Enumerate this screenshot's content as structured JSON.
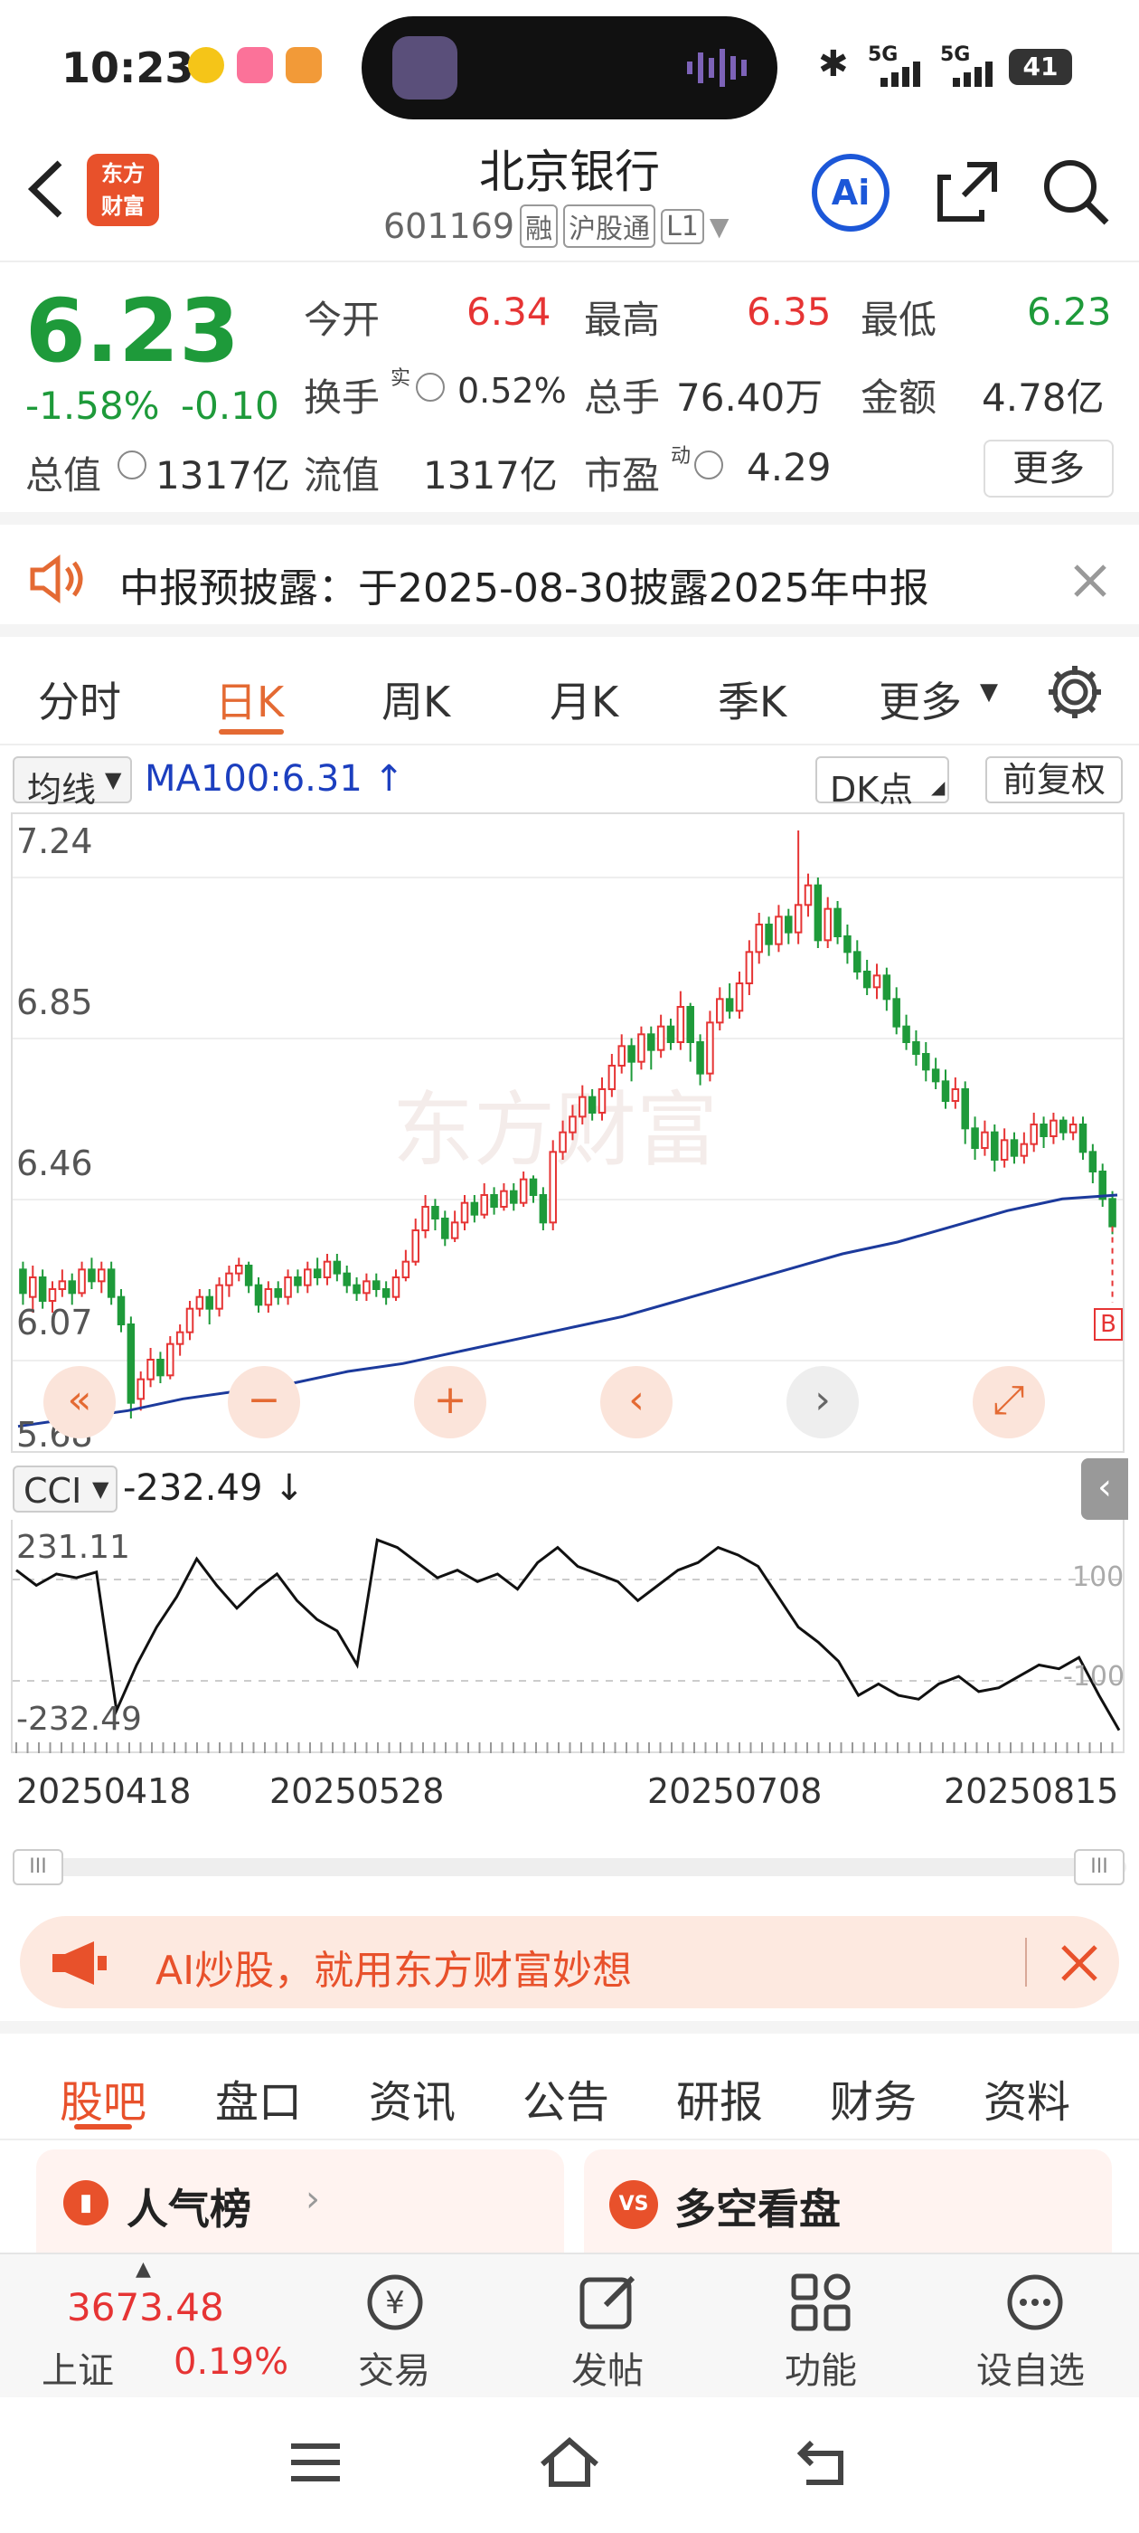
{
  "status": {
    "time": "10:23",
    "battery": "41",
    "sig1": "5G",
    "sig2": "5G"
  },
  "header": {
    "logo_line1": "东方",
    "logo_line2": "财富",
    "title": "北京银行",
    "code": "601169",
    "tag1": "融",
    "tag2": "沪股通",
    "tag3": "L1",
    "ai_label": "Ai"
  },
  "quote": {
    "price": "6.23",
    "change_pct": "-1.58%",
    "change": "-0.10",
    "open_label": "今开",
    "open": "6.34",
    "high_label": "最高",
    "high": "6.35",
    "low_label": "最低",
    "low": "6.23",
    "turnover_label": "换手",
    "turnover_sup": "实",
    "turnover": "0.52%",
    "volume_label": "总手",
    "volume": "76.40万",
    "amount_label": "金额",
    "amount": "4.78亿",
    "mktcap_label": "总值",
    "mktcap": "1317亿",
    "float_label": "流值",
    "float_cap": "1317亿",
    "pe_label": "市盈",
    "pe_sup": "动",
    "pe": "4.29",
    "more_label": "更多"
  },
  "notice": {
    "text": "中报预披露：于2025-08-30披露2025年中报"
  },
  "period_tabs": [
    "分时",
    "日K",
    "周K",
    "月K",
    "季K",
    "更多"
  ],
  "chart_controls": {
    "ma_select": "均线",
    "ma_value": "MA100:6.31 ↑",
    "dk_select": "DK点",
    "adjust": "前复权",
    "b_marker": "B"
  },
  "indicator": {
    "name": "CCI",
    "value": "-232.49 ↓",
    "axis_top": "231.11",
    "axis_bottom": "-232.49",
    "ref_hi": "100",
    "ref_lo": "-100"
  },
  "chart_data": {
    "type": "candlestick",
    "y_ticks": [
      "7.24",
      "6.85",
      "6.46",
      "6.07",
      "5.68"
    ],
    "ylim": [
      5.68,
      7.24
    ],
    "x_ticks": [
      "20250418",
      "20250528",
      "20250708",
      "20250815"
    ],
    "watermark": "东方财富",
    "candles": [
      [
        6.12,
        6.06,
        6.14,
        6.03
      ],
      [
        6.05,
        6.1,
        6.13,
        6.01
      ],
      [
        6.1,
        6.04,
        6.12,
        6.02
      ],
      [
        6.04,
        6.07,
        6.09,
        6.01
      ],
      [
        6.07,
        6.09,
        6.12,
        6.05
      ],
      [
        6.09,
        6.06,
        6.11,
        6.03
      ],
      [
        6.06,
        6.12,
        6.14,
        6.05
      ],
      [
        6.12,
        6.09,
        6.15,
        6.07
      ],
      [
        6.09,
        6.12,
        6.14,
        6.06
      ],
      [
        6.12,
        6.05,
        6.14,
        6.03
      ],
      [
        6.05,
        5.98,
        6.07,
        5.96
      ],
      [
        5.98,
        5.78,
        6.0,
        5.74
      ],
      [
        5.79,
        5.84,
        5.86,
        5.76
      ],
      [
        5.84,
        5.89,
        5.92,
        5.82
      ],
      [
        5.89,
        5.85,
        5.91,
        5.83
      ],
      [
        5.85,
        5.93,
        5.95,
        5.84
      ],
      [
        5.93,
        5.96,
        5.98,
        5.9
      ],
      [
        5.96,
        6.02,
        6.04,
        5.94
      ],
      [
        6.02,
        6.05,
        6.07,
        6.0
      ],
      [
        6.05,
        6.02,
        6.07,
        5.98
      ],
      [
        6.02,
        6.08,
        6.1,
        6.0
      ],
      [
        6.08,
        6.11,
        6.13,
        6.05
      ],
      [
        6.11,
        6.13,
        6.15,
        6.09
      ],
      [
        6.13,
        6.08,
        6.14,
        6.06
      ],
      [
        6.08,
        6.03,
        6.1,
        6.01
      ],
      [
        6.03,
        6.07,
        6.09,
        6.01
      ],
      [
        6.07,
        6.05,
        6.09,
        6.03
      ],
      [
        6.05,
        6.1,
        6.12,
        6.03
      ],
      [
        6.1,
        6.08,
        6.12,
        6.06
      ],
      [
        6.08,
        6.12,
        6.14,
        6.06
      ],
      [
        6.12,
        6.1,
        6.15,
        6.08
      ],
      [
        6.1,
        6.14,
        6.16,
        6.08
      ],
      [
        6.14,
        6.11,
        6.16,
        6.09
      ],
      [
        6.11,
        6.08,
        6.13,
        6.06
      ],
      [
        6.08,
        6.06,
        6.1,
        6.04
      ],
      [
        6.06,
        6.09,
        6.11,
        6.04
      ],
      [
        6.09,
        6.07,
        6.11,
        6.05
      ],
      [
        6.07,
        6.05,
        6.09,
        6.03
      ],
      [
        6.05,
        6.1,
        6.12,
        6.04
      ],
      [
        6.1,
        6.14,
        6.17,
        6.09
      ],
      [
        6.14,
        6.22,
        6.25,
        6.13
      ],
      [
        6.22,
        6.28,
        6.31,
        6.2
      ],
      [
        6.28,
        6.25,
        6.3,
        6.22
      ],
      [
        6.25,
        6.2,
        6.27,
        6.18
      ],
      [
        6.2,
        6.24,
        6.27,
        6.19
      ],
      [
        6.24,
        6.29,
        6.31,
        6.22
      ],
      [
        6.29,
        6.26,
        6.31,
        6.24
      ],
      [
        6.26,
        6.31,
        6.34,
        6.25
      ],
      [
        6.31,
        6.28,
        6.33,
        6.26
      ],
      [
        6.28,
        6.32,
        6.34,
        6.27
      ],
      [
        6.32,
        6.29,
        6.34,
        6.27
      ],
      [
        6.29,
        6.35,
        6.37,
        6.28
      ],
      [
        6.35,
        6.31,
        6.36,
        6.29
      ],
      [
        6.31,
        6.24,
        6.33,
        6.22
      ],
      [
        6.24,
        6.42,
        6.45,
        6.22
      ],
      [
        6.42,
        6.47,
        6.5,
        6.4
      ],
      [
        6.47,
        6.51,
        6.54,
        6.45
      ],
      [
        6.51,
        6.56,
        6.59,
        6.49
      ],
      [
        6.56,
        6.52,
        6.58,
        6.5
      ],
      [
        6.52,
        6.58,
        6.61,
        6.5
      ],
      [
        6.58,
        6.64,
        6.67,
        6.56
      ],
      [
        6.64,
        6.69,
        6.72,
        6.62
      ],
      [
        6.69,
        6.65,
        6.71,
        6.6
      ],
      [
        6.65,
        6.72,
        6.74,
        6.63
      ],
      [
        6.72,
        6.68,
        6.74,
        6.63
      ],
      [
        6.68,
        6.74,
        6.77,
        6.66
      ],
      [
        6.74,
        6.7,
        6.76,
        6.68
      ],
      [
        6.7,
        6.79,
        6.83,
        6.68
      ],
      [
        6.79,
        6.7,
        6.8,
        6.65
      ],
      [
        6.7,
        6.62,
        6.72,
        6.59
      ],
      [
        6.62,
        6.75,
        6.78,
        6.6
      ],
      [
        6.75,
        6.81,
        6.84,
        6.73
      ],
      [
        6.81,
        6.78,
        6.85,
        6.76
      ],
      [
        6.78,
        6.85,
        6.88,
        6.76
      ],
      [
        6.85,
        6.93,
        6.96,
        6.82
      ],
      [
        6.93,
        7.0,
        7.03,
        6.9
      ],
      [
        7.0,
        6.95,
        7.02,
        6.92
      ],
      [
        6.95,
        7.02,
        7.05,
        6.93
      ],
      [
        7.02,
        6.98,
        7.04,
        6.95
      ],
      [
        6.98,
        7.05,
        7.24,
        6.95
      ],
      [
        7.05,
        7.1,
        7.13,
        7.02
      ],
      [
        7.1,
        6.96,
        7.12,
        6.94
      ],
      [
        6.96,
        7.04,
        7.07,
        6.94
      ],
      [
        7.04,
        6.97,
        7.06,
        6.95
      ],
      [
        6.97,
        6.93,
        7.0,
        6.9
      ],
      [
        6.93,
        6.88,
        6.96,
        6.86
      ],
      [
        6.88,
        6.84,
        6.91,
        6.82
      ],
      [
        6.84,
        6.87,
        6.9,
        6.81
      ],
      [
        6.87,
        6.81,
        6.89,
        6.78
      ],
      [
        6.81,
        6.74,
        6.84,
        6.72
      ],
      [
        6.74,
        6.7,
        6.77,
        6.68
      ],
      [
        6.7,
        6.67,
        6.73,
        6.64
      ],
      [
        6.67,
        6.63,
        6.7,
        6.6
      ],
      [
        6.63,
        6.6,
        6.66,
        6.58
      ],
      [
        6.6,
        6.55,
        6.63,
        6.53
      ],
      [
        6.55,
        6.58,
        6.61,
        6.53
      ],
      [
        6.58,
        6.48,
        6.6,
        6.44
      ],
      [
        6.48,
        6.43,
        6.51,
        6.4
      ],
      [
        6.43,
        6.47,
        6.5,
        6.41
      ],
      [
        6.47,
        6.4,
        6.49,
        6.37
      ],
      [
        6.4,
        6.45,
        6.48,
        6.38
      ],
      [
        6.45,
        6.41,
        6.47,
        6.39
      ],
      [
        6.41,
        6.44,
        6.47,
        6.39
      ],
      [
        6.44,
        6.49,
        6.52,
        6.42
      ],
      [
        6.49,
        6.46,
        6.51,
        6.43
      ],
      [
        6.46,
        6.5,
        6.52,
        6.44
      ],
      [
        6.5,
        6.47,
        6.51,
        6.45
      ],
      [
        6.47,
        6.49,
        6.51,
        6.45
      ],
      [
        6.49,
        6.42,
        6.51,
        6.4
      ],
      [
        6.42,
        6.37,
        6.44,
        6.34
      ],
      [
        6.37,
        6.3,
        6.39,
        6.28
      ],
      [
        6.3,
        6.23,
        6.32,
        6.21
      ]
    ],
    "ma100": [
      5.72,
      5.74,
      5.76,
      5.79,
      5.81,
      5.83,
      5.86,
      5.88,
      5.91,
      5.94,
      5.97,
      6.0,
      6.04,
      6.08,
      6.12,
      6.16,
      6.19,
      6.23,
      6.27,
      6.3,
      6.31
    ],
    "cci": [
      190,
      150,
      180,
      170,
      185,
      -180,
      -60,
      40,
      120,
      220,
      150,
      90,
      140,
      180,
      110,
      60,
      30,
      -60,
      270,
      250,
      210,
      170,
      190,
      160,
      180,
      140,
      210,
      250,
      200,
      180,
      160,
      110,
      150,
      190,
      210,
      250,
      230,
      200,
      120,
      40,
      0,
      -50,
      -140,
      -110,
      -140,
      -150,
      -110,
      -90,
      -130,
      -120,
      -90,
      -60,
      -70,
      -40,
      -140,
      -232
    ]
  },
  "chart_buttons": [
    "«",
    "−",
    "+",
    "‹",
    "›",
    "⤢"
  ],
  "ai_banner": {
    "text": "AI炒股，就用东方财富妙想"
  },
  "bottom_tabs": [
    "股吧",
    "盘口",
    "资讯",
    "公告",
    "研报",
    "财务",
    "资料"
  ],
  "cards": {
    "left": "人气榜",
    "right": "多空看盘"
  },
  "bottom_nav": {
    "index_value": "3673.48",
    "index_name": "上证",
    "index_change": "0.19%",
    "trade": "交易",
    "post": "发帖",
    "functions": "功能",
    "watch": "设自选"
  }
}
